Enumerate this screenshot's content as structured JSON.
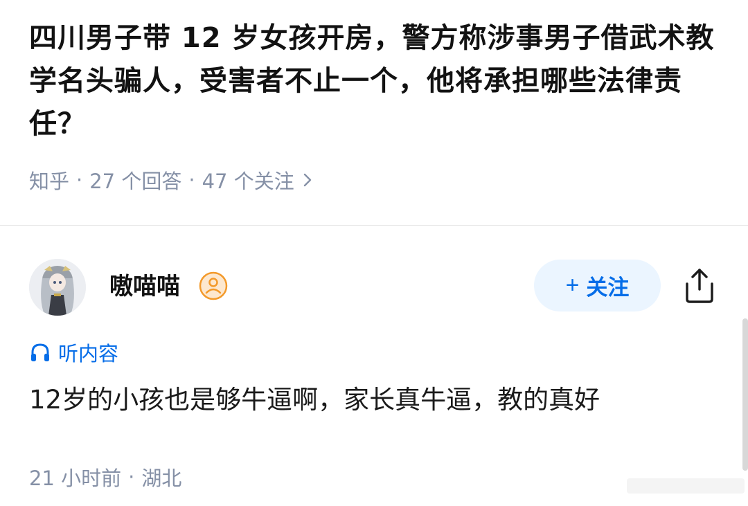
{
  "question": {
    "title": "四川男子带 12 岁女孩开房，警方称涉事男子借武术教学名头骗人，受害者不止一个，他将承担哪些法律责任？",
    "source": "知乎",
    "answers_count": "27 个回答",
    "followers_count": "47 个关注",
    "chevron_icon": "chevron-right-icon"
  },
  "answer": {
    "author": {
      "name": "嗷喵喵",
      "avatar_icon": "anime-avatar",
      "badge_icon": "user-badge-icon"
    },
    "follow_label": "关注",
    "follow_icon": "plus-icon",
    "share_icon": "share-icon",
    "listen_label": "听内容",
    "listen_icon": "headphone-icon",
    "content": "12岁的小孩也是够牛逼啊，家长真牛逼，教的真好",
    "time": "21 小时前",
    "location": "湖北"
  },
  "colors": {
    "accent": "#056de8",
    "follow_bg": "#ebf5ff",
    "meta_gray": "#8590a6",
    "badge_orange": "#f39a2b"
  }
}
